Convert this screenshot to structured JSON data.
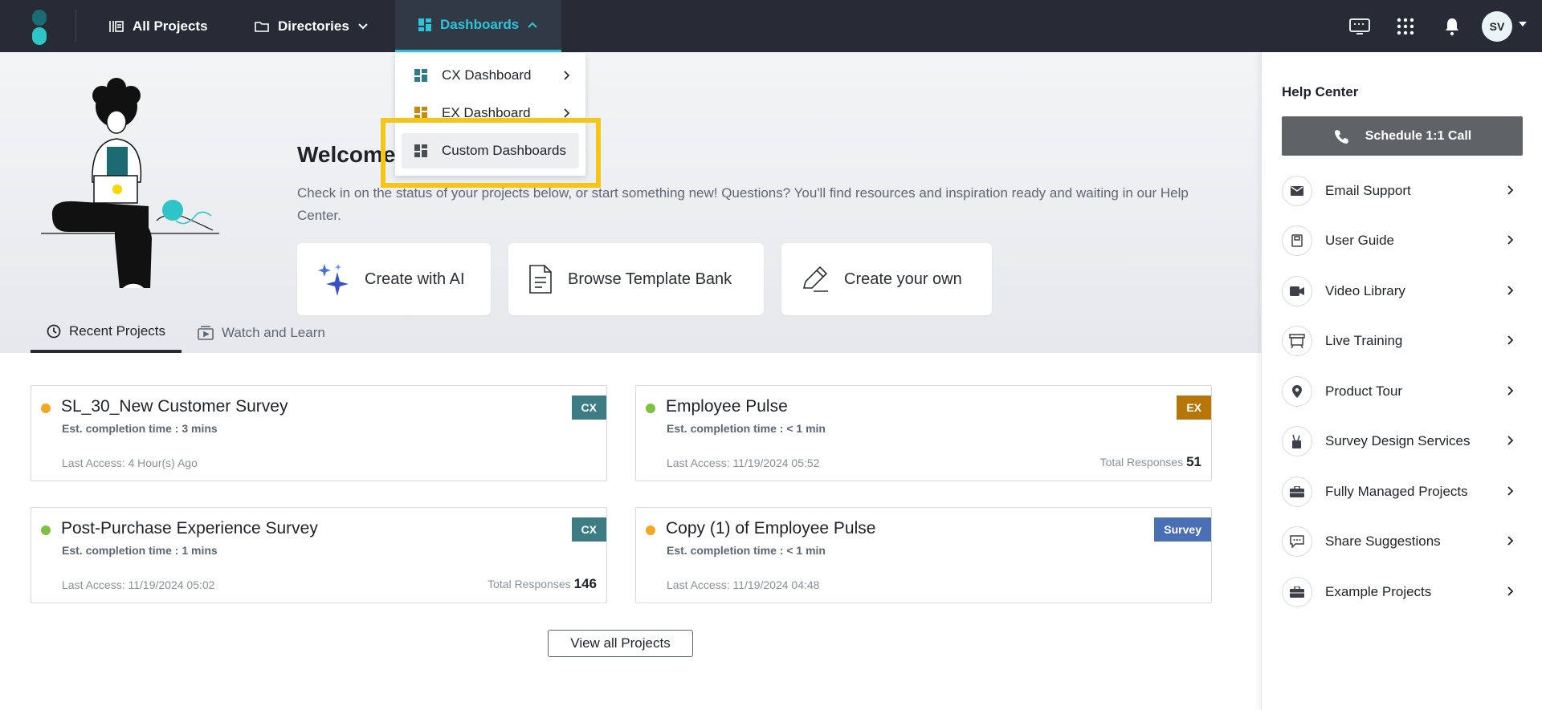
{
  "nav": {
    "all_projects": "All Projects",
    "directories": "Directories",
    "dashboards": "Dashboards",
    "avatar_initials": "SV"
  },
  "dropdown": {
    "items": [
      {
        "label": "CX Dashboard",
        "icon_color": "#2e7d8a"
      },
      {
        "label": "EX Dashboard",
        "icon_color": "#c98a0e"
      },
      {
        "label": "Custom Dashboards",
        "icon_color": "#4a4f57"
      }
    ]
  },
  "hero": {
    "welcome": "Welcome",
    "intro": "Check in on the status of your projects below, or start something new! Questions? You'll find resources and inspiration ready and waiting in our Help Center.",
    "actions": [
      "Create with AI",
      "Browse Template Bank",
      "Create your own"
    ]
  },
  "tabs": [
    "Recent Projects",
    "Watch and Learn"
  ],
  "projects": [
    {
      "title": "SL_30_New Customer Survey",
      "est": "Est. completion time : 3 mins",
      "last": "Last Access: 4 Hour(s) Ago",
      "badge": "CX",
      "badge_color": "#3c7c82",
      "status_color": "#f5a623",
      "resp_label": "",
      "resp_value": ""
    },
    {
      "title": "Employee Pulse",
      "est": "Est. completion time : < 1 min",
      "last": "Last Access: 11/19/2024 05:52",
      "badge": "EX",
      "badge_color": "#b8760a",
      "status_color": "#7cc142",
      "resp_label": "Total Responses",
      "resp_value": "51"
    },
    {
      "title": "Post-Purchase Experience Survey",
      "est": "Est. completion time : 1 mins",
      "last": "Last Access: 11/19/2024 05:02",
      "badge": "CX",
      "badge_color": "#3c7c82",
      "status_color": "#7cc142",
      "resp_label": "Total Responses",
      "resp_value": "146"
    },
    {
      "title": "Copy (1) of Employee Pulse",
      "est": "Est. completion time : < 1 min",
      "last": "Last Access: 11/19/2024 04:48",
      "badge": "Survey",
      "badge_color": "#4a6fb5",
      "status_color": "#f5a623",
      "resp_label": "",
      "resp_value": ""
    }
  ],
  "view_all": "View all Projects",
  "help": {
    "title": "Help Center",
    "schedule": "Schedule 1:1 Call",
    "items": [
      {
        "label": "Email Support",
        "icon": "mail-icon"
      },
      {
        "label": "User Guide",
        "icon": "book-icon"
      },
      {
        "label": "Video Library",
        "icon": "video-icon"
      },
      {
        "label": "Live Training",
        "icon": "presentation-icon"
      },
      {
        "label": "Product Tour",
        "icon": "location-pin-icon"
      },
      {
        "label": "Survey Design Services",
        "icon": "design-tools-icon"
      },
      {
        "label": "Fully Managed Projects",
        "icon": "briefcase-icon"
      },
      {
        "label": "Share Suggestions",
        "icon": "chat-bubble-icon"
      },
      {
        "label": "Example Projects",
        "icon": "briefcase-icon"
      }
    ]
  }
}
